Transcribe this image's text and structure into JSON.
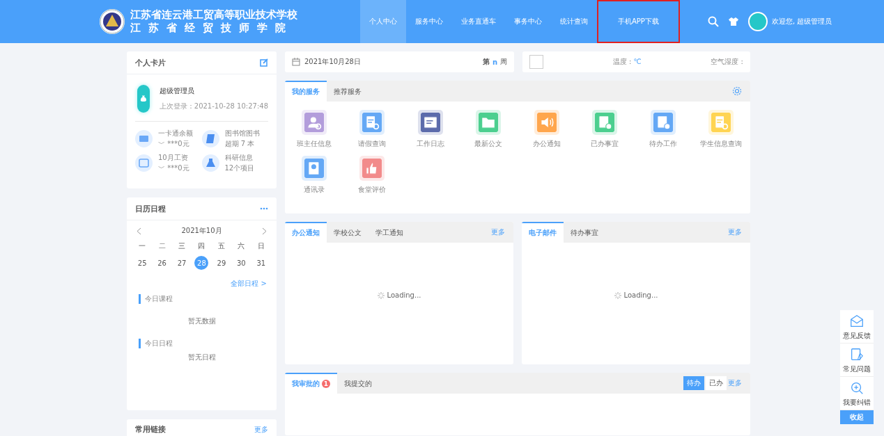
{
  "header": {
    "school_name": "江苏省连云港工贸高等职业技术学校",
    "school_name_2": "江 苏 省 经 贸 技 师 学 院",
    "nav": [
      {
        "label": "个人中心",
        "selected": true,
        "highlighted": false
      },
      {
        "label": "服务中心",
        "selected": false,
        "highlighted": false
      },
      {
        "label": "业务直通车",
        "selected": false,
        "highlighted": false
      },
      {
        "label": "事务中心",
        "selected": false,
        "highlighted": false
      },
      {
        "label": "统计查询",
        "selected": false,
        "highlighted": false
      },
      {
        "label": "手机APP下载",
        "selected": false,
        "highlighted": true
      }
    ],
    "welcome": "欢迎您, 超级管理员"
  },
  "profile_card": {
    "title": "个人卡片",
    "name": "超级管理员",
    "last_login": "上次登录：2021-10-28 10:27:48",
    "stats": [
      {
        "kind": "card",
        "label": "一卡通余额",
        "value": "﹀ ***0元"
      },
      {
        "kind": "book",
        "label": "图书馆图书",
        "value": "超期  7 本"
      },
      {
        "kind": "wallet",
        "label": "10月工资",
        "value": "﹀ ***0元"
      },
      {
        "kind": "flask",
        "label": "科研信息",
        "value": "12个项目"
      }
    ]
  },
  "calendar_card": {
    "title": "日历日程",
    "month": "2021年10月",
    "weekdays": [
      "一",
      "二",
      "三",
      "四",
      "五",
      "六",
      "日"
    ],
    "days": [
      {
        "label": "25",
        "selected": false
      },
      {
        "label": "26",
        "selected": false
      },
      {
        "label": "27",
        "selected": false
      },
      {
        "label": "28",
        "selected": true
      },
      {
        "label": "29",
        "selected": false
      },
      {
        "label": "30",
        "selected": false
      },
      {
        "label": "31",
        "selected": false
      }
    ],
    "all_link": "全部日程 >",
    "sections": [
      {
        "title": "今日课程",
        "empty": "暂无数据"
      },
      {
        "title": "今日日程",
        "empty": "暂无日程"
      }
    ]
  },
  "links_card": {
    "title": "常用链接",
    "more": "更多"
  },
  "date_bar": {
    "date": "2021年10月28日",
    "week_prefix": "第",
    "week_number": "n",
    "week_suffix": "周"
  },
  "weather_bar": {
    "temperature": "温度 : ",
    "unit": "℃",
    "humidity": "空气湿度 : "
  },
  "services": {
    "tabs": [
      {
        "label": "我的服务",
        "selected": true
      },
      {
        "label": "推荐服务",
        "selected": false
      }
    ],
    "items": [
      {
        "label": "班主任信息",
        "kind": "person",
        "color": "#b39ddb"
      },
      {
        "label": "请假查询",
        "kind": "doc",
        "color": "#64a8f5"
      },
      {
        "label": "工作日志",
        "kind": "calendar",
        "color": "#5c6bab"
      },
      {
        "label": "最新公文",
        "kind": "folder",
        "color": "#4ccf8f"
      },
      {
        "label": "办公通知",
        "kind": "speaker",
        "color": "#ffa64d"
      },
      {
        "label": "已办事宜",
        "kind": "check",
        "color": "#4ccf8f"
      },
      {
        "label": "待办工作",
        "kind": "clock",
        "color": "#64a8f5"
      },
      {
        "label": "学生信息查询",
        "kind": "doc",
        "color": "#ffd452"
      },
      {
        "label": "通讯录",
        "kind": "contacts",
        "color": "#64a8f5"
      },
      {
        "label": "食堂评价",
        "kind": "thumb",
        "color": "#f28b8b"
      }
    ]
  },
  "notice_panel": {
    "tabs": [
      {
        "label": "办公通知",
        "selected": true
      },
      {
        "label": "学校公文",
        "selected": false
      },
      {
        "label": "学工通知",
        "selected": false
      }
    ],
    "more": "更多",
    "loading": "Loading..."
  },
  "mail_panel": {
    "tabs": [
      {
        "label": "电子邮件",
        "selected": true
      },
      {
        "label": "待办事宜",
        "selected": false
      }
    ],
    "more": "更多",
    "loading": "Loading..."
  },
  "approval_panel": {
    "tabs": [
      {
        "label": "我审批的",
        "selected": true,
        "badge": "1"
      },
      {
        "label": "我提交的",
        "selected": false
      }
    ],
    "filters": [
      {
        "label": "待办",
        "selected": true
      },
      {
        "label": "已办",
        "selected": false
      }
    ],
    "more": "更多"
  },
  "side_tools": {
    "items": [
      {
        "kind": "mail",
        "label": "意见反馈"
      },
      {
        "kind": "question",
        "label": "常见问题"
      },
      {
        "kind": "search",
        "label": "我要纠错"
      }
    ],
    "collapse": "收起"
  }
}
